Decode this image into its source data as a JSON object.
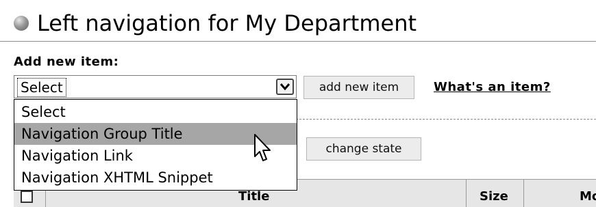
{
  "header": {
    "icon": "globe-bullet-icon",
    "title": "Left navigation for My Department"
  },
  "add_item": {
    "label": "Add new item:",
    "select": {
      "selected": "Select",
      "options": [
        "Select",
        "Navigation Group Title",
        "Navigation Link",
        "Navigation XHTML Snippet"
      ],
      "highlighted_index": 1,
      "expanded": true
    },
    "add_button": "add new item",
    "help_link": "What's an item?"
  },
  "actions": {
    "change_state_button": "change state"
  },
  "table": {
    "columns": [
      "",
      "Title",
      "Size",
      "Mo"
    ]
  },
  "colors": {
    "highlight": "#a6a6a6",
    "button_bg": "#ececec",
    "header_bg": "#e6e6e6"
  }
}
